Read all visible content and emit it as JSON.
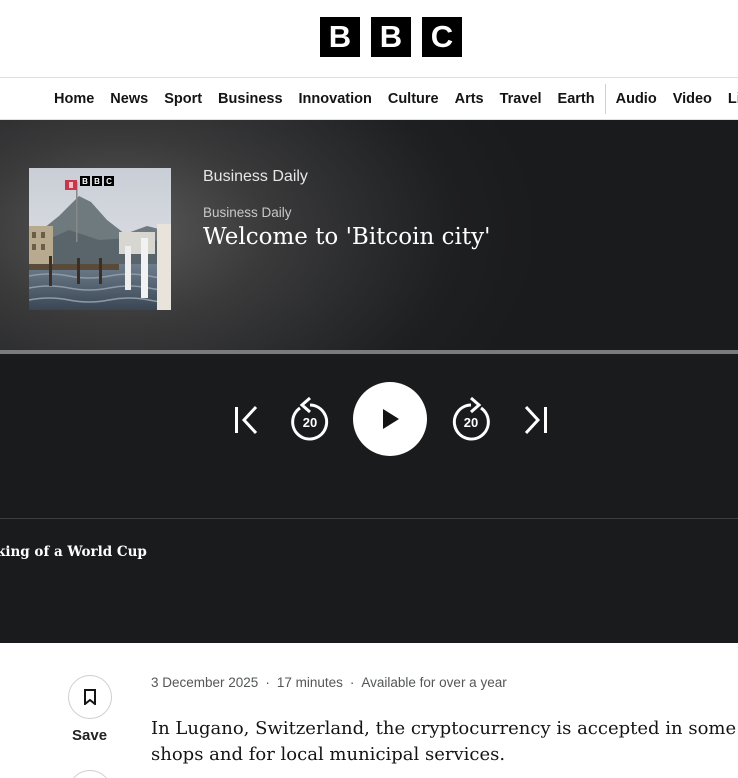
{
  "header": {
    "logo_letters": [
      "B",
      "B",
      "C"
    ]
  },
  "nav": {
    "items": [
      "Home",
      "News",
      "Sport",
      "Business",
      "Innovation",
      "Culture",
      "Arts",
      "Travel",
      "Earth"
    ],
    "items_after_divider": [
      "Audio",
      "Video",
      "Live"
    ]
  },
  "player": {
    "artwork_logo_letters": [
      "B",
      "B",
      "C"
    ],
    "show_name": "Business Daily",
    "series_name": "Business Daily",
    "episode_title": "Welcome to 'Bitcoin city'",
    "progress": 0,
    "rewind_seconds": "20",
    "forward_seconds": "20",
    "next_up_title": "king of a World Cup"
  },
  "episode": {
    "date": "3 December 2025",
    "duration": "17 minutes",
    "availability": "Available for over a year",
    "separator": "·",
    "save_label": "Save",
    "description": "In Lugano, Switzerland, the cryptocurrency is accepted in some shops and for local municipal services."
  },
  "colors": {
    "player_bg": "#1a1b1d",
    "progress_track": "#7b7b7b",
    "text_primary": "#141414",
    "text_meta": "#545658"
  },
  "icons": {
    "skip_prev": "skip-previous-icon",
    "rewind": "rewind-20-icon",
    "play": "play-icon",
    "forward": "forward-20-icon",
    "skip_next": "skip-next-icon",
    "save": "bookmark-icon"
  }
}
